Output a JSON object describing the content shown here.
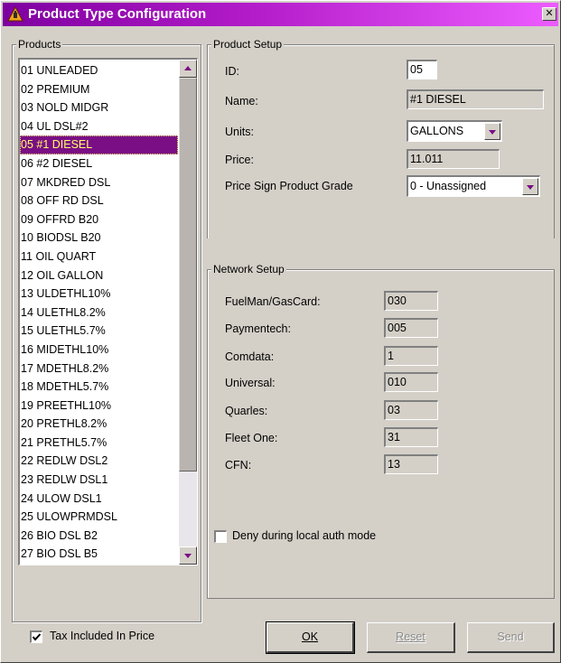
{
  "window": {
    "title": "Product Type Configuration",
    "close_glyph": "✕",
    "accent": "#b31cc9"
  },
  "products": {
    "legend": "Products",
    "selected_index": 4,
    "items": [
      "01 UNLEADED",
      "02 PREMIUM",
      "03 NOLD MIDGR",
      "04 UL DSL#2",
      "05 #1 DIESEL",
      "06 #2 DIESEL",
      "07 MKDRED DSL",
      "08 OFF RD DSL",
      "09 OFFRD B20",
      "10 BIODSL B20",
      "11 OIL QUART",
      "12 OIL GALLON",
      "13 ULDETHL10%",
      "14 ULETHL8.2%",
      "15 ULETHL5.7%",
      "16 MIDETHL10%",
      "17 MDETHL8.2%",
      "18 MDETHL5.7%",
      "19 PREETHL10%",
      "20 PRETHL8.2%",
      "21 PRETHL5.7%",
      "22 REDLW DSL2",
      "23 REDLW DSL1",
      "24 ULOW DSL1",
      "25 ULOWPRMDSL",
      "26 BIO DSL B2",
      "27 BIO DSL B5"
    ]
  },
  "product_setup": {
    "legend": "Product Setup",
    "id_label": "ID:",
    "id_value": "05",
    "name_label": "Name:",
    "name_value": "#1 DIESEL",
    "units_label": "Units:",
    "units_value": "GALLONS",
    "price_label": "Price:",
    "price_value": "11.011",
    "grade_label": "Price Sign Product Grade",
    "grade_value": "0 - Unassigned"
  },
  "network_setup": {
    "legend": "Network Setup",
    "rows": [
      {
        "label": "FuelMan/GasCard:",
        "value": "030"
      },
      {
        "label": "Paymentech:",
        "value": "005"
      },
      {
        "label": "Comdata:",
        "value": "1"
      },
      {
        "label": "Universal:",
        "value": "010"
      },
      {
        "label": "Quarles:",
        "value": "03"
      },
      {
        "label": "Fleet One:",
        "value": "31"
      },
      {
        "label": "CFN:",
        "value": "13"
      }
    ],
    "deny_label": "Deny during local auth mode",
    "deny_checked": false
  },
  "footer": {
    "tax_label": "Tax Included In Price",
    "tax_checked": true,
    "ok_label": "OK",
    "reset_label": "Reset",
    "send_label": "Send"
  },
  "icons": {
    "title": "warning-fuel-icon",
    "close": "close-icon",
    "scroll_up": "arrow-up-icon",
    "scroll_down": "arrow-down-icon",
    "combo": "arrow-down-icon",
    "check": "checkmark-icon"
  }
}
